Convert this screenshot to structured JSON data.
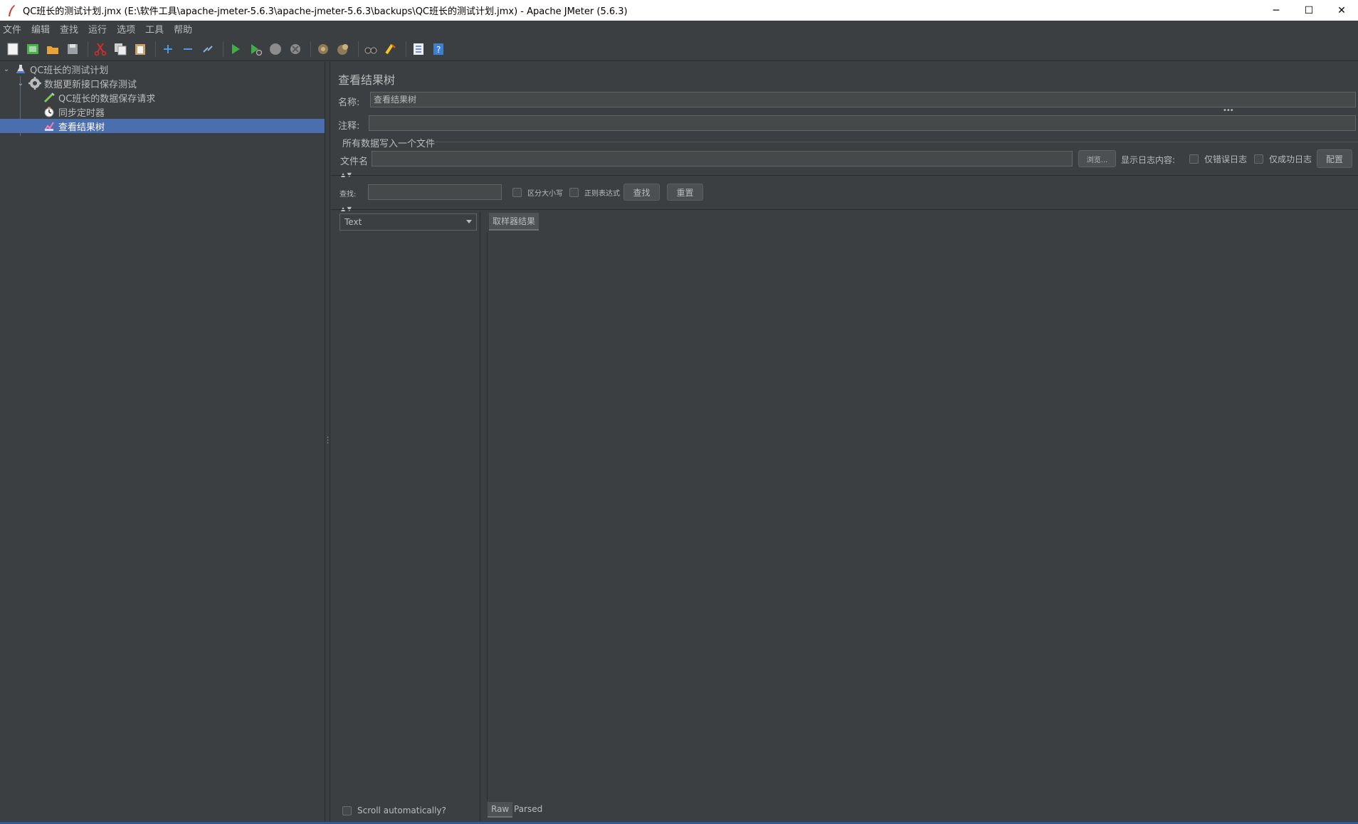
{
  "window": {
    "title": "QC班长的测试计划.jmx (E:\\软件工具\\apache-jmeter-5.6.3\\apache-jmeter-5.6.3\\backups\\QC班长的测试计划.jmx) - Apache JMeter (5.6.3)",
    "minimize_glyph": "─",
    "maximize_glyph": "☐",
    "close_glyph": "✕"
  },
  "menu": [
    "文件",
    "编辑",
    "查找",
    "运行",
    "选项",
    "工具",
    "帮助"
  ],
  "toolbar": {
    "icons": [
      "new-icon",
      "templates-icon",
      "open-icon",
      "save-icon",
      "cut-icon",
      "copy-icon",
      "paste-icon",
      "expand-icon",
      "collapse-icon",
      "toggle-icon",
      "start-icon",
      "start-no-pause-icon",
      "stop-icon",
      "shutdown-icon",
      "clear-icon",
      "clear-all-icon",
      "search-icon",
      "reset-search-icon",
      "function-helper-icon",
      "help-icon"
    ]
  },
  "tree": {
    "items": [
      {
        "label": "QC班长的测试计划",
        "icon": "test-plan-icon",
        "level": 0
      },
      {
        "label": "数据更新接口保存测试",
        "icon": "thread-group-icon",
        "level": 1
      },
      {
        "label": "QC班长的数据保存请求",
        "icon": "http-sampler-icon",
        "level": 2
      },
      {
        "label": "同步定时器",
        "icon": "timer-icon",
        "level": 2
      },
      {
        "label": "查看结果树",
        "icon": "listener-icon",
        "level": 2,
        "selected": true
      }
    ]
  },
  "panel": {
    "heading": "查看结果树",
    "name_label": "名称:",
    "name_value": "查看结果树",
    "comment_label": "注释:",
    "comment_value": "",
    "file_section": "所有数据写入一个文件",
    "filename_label": "文件名",
    "filename_value": "",
    "browse_button": "浏览...",
    "log_display_label": "显示日志内容:",
    "errors_only": "仅错误日志",
    "successes_only": "仅成功日志",
    "configure_button": "配置",
    "search_label": "查找:",
    "search_value": "",
    "case_sensitive": "区分大小写",
    "regex": "正则表达式",
    "find_button": "查找",
    "reset_button": "重置",
    "renderer_selected": "Text",
    "sampler_result_tab": "取样器结果",
    "scroll_auto": "Scroll automatically?",
    "raw_tab": "Raw",
    "parsed_tab": "Parsed"
  }
}
